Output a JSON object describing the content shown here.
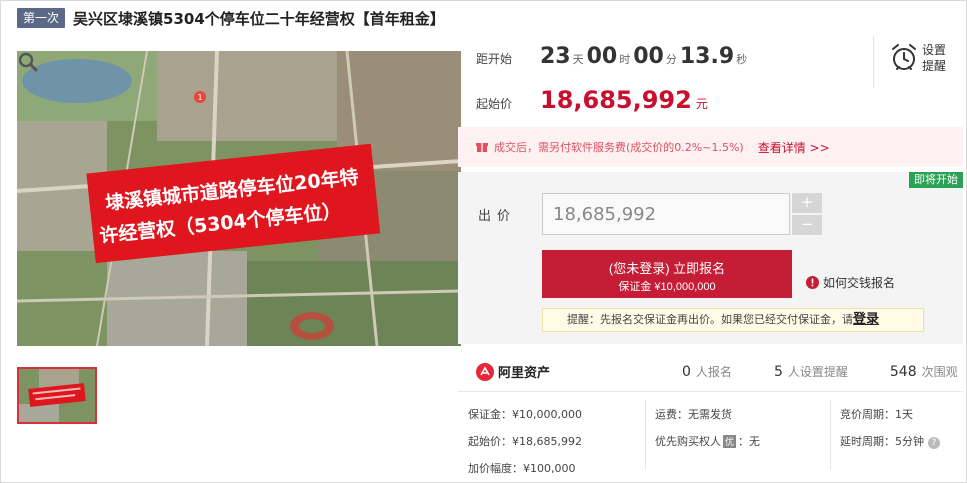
{
  "header": {
    "round_badge": "第一次",
    "title": "吴兴区埭溪镇5304个停车位二十年经营权【首年租金】"
  },
  "image": {
    "banner_line1": "埭溪镇城市道路停车位20年特",
    "banner_line2": "许经营权（5304个停车位）",
    "map_pin": "1",
    "zoom_icon": "magnifier-icon",
    "thumb_banner": "埭溪镇城市道路停车位20年特许经营权（5304个停车位）"
  },
  "timer": {
    "label": "距开始",
    "days": "23",
    "days_unit": "天",
    "hours": "00",
    "hours_unit": "时",
    "minutes": "00",
    "minutes_unit": "分",
    "seconds": "13.9",
    "seconds_unit": "秒"
  },
  "start_price": {
    "label": "起始价",
    "value": "18,685,992",
    "unit": "元"
  },
  "reminder": {
    "line1": "设置",
    "line2": "提醒",
    "icon": "alarm-clock-icon"
  },
  "notice": {
    "icon": "gift-icon",
    "text": "成交后，需另付软件服务费(成交价的0.2%~1.5%)",
    "link": "查看详情 >>"
  },
  "bid": {
    "soon_badge": "即将开始",
    "label": "出价",
    "input_value": "18,685,992",
    "plus": "+",
    "minus": "−",
    "signup_main": "(您未登录) 立即报名",
    "signup_sub": "保证金 ¥10,000,000",
    "how_pay": "如何交钱报名",
    "hint_text": "提醒：先报名交保证金再出价。如果您已经交付保证金，请",
    "hint_link": "登录"
  },
  "stats": {
    "brand": "阿里资产",
    "signups_num": "0",
    "signups_label": "人报名",
    "reminders_num": "5",
    "reminders_label": "人设置提醒",
    "views_num": "548",
    "views_label": "次围观"
  },
  "info": {
    "deposit": "保证金：¥10,000,000",
    "start_price": "起始价：¥18,685,992",
    "increment": "加价幅度：¥100,000",
    "shipping": "运费：无需发货",
    "priority_label": "优先购买权人",
    "priority_badge": "优",
    "priority_value": "：无",
    "cycle": "竞价周期：1天",
    "delay": "延时周期：5分钟",
    "help": "?"
  },
  "colors": {
    "accent_red": "#c51d36",
    "price_red": "#c8102e",
    "badge_blue": "#5a6a86",
    "soon_green": "#2aa154"
  }
}
